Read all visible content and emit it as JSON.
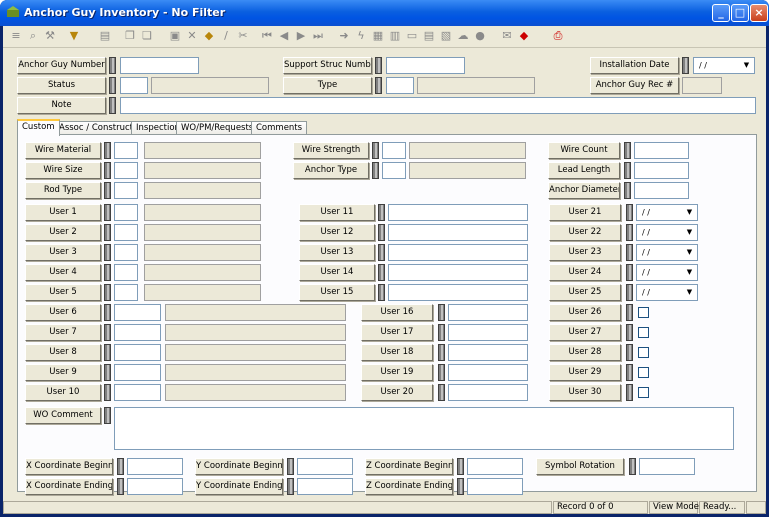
{
  "window": {
    "title": "Anchor Guy Inventory - No Filter"
  },
  "header_fields": {
    "anchor_guy_number": "Anchor Guy Number",
    "support_struc_number": "Support Struc Number",
    "installation_date": "Installation Date",
    "installation_date_value": "/ /",
    "status": "Status",
    "type": "Type",
    "anchor_guy_rec": "Anchor Guy Rec #",
    "note": "Note"
  },
  "tabs": [
    "Custom",
    "Assoc / Construct",
    "Inspection",
    "WO/PM/Requests",
    "Comments"
  ],
  "custom": {
    "wire_material": "Wire Material",
    "wire_size": "Wire Size",
    "rod_type": "Rod Type",
    "wire_strength": "Wire Strength",
    "anchor_type": "Anchor Type",
    "wire_count": "Wire Count",
    "lead_length": "Lead Length",
    "anchor_diameter": "Anchor Diameter",
    "users_col1": [
      "User 1",
      "User 2",
      "User 3",
      "User 4",
      "User 5",
      "User 6",
      "User 7",
      "User 8",
      "User 9",
      "User 10"
    ],
    "users_col2": [
      "User 11",
      "User 12",
      "User 13",
      "User 14",
      "User 15"
    ],
    "users_col2b": [
      "User 16",
      "User 17",
      "User 18",
      "User 19",
      "User 20"
    ],
    "users_col3": [
      "User 21",
      "User 22",
      "User 23",
      "User 24",
      "User 25"
    ],
    "users_col3b": [
      "User 26",
      "User 27",
      "User 28",
      "User 29",
      "User 30"
    ],
    "date_value": "/ /",
    "wo_comment": "WO Comment",
    "x_begin": "X Coordinate Beginning",
    "x_end": "X Coordinate Ending",
    "y_begin": "Y Coordinate Beginning",
    "y_end": "Y Coordinate Ending",
    "z_begin": "Z Coordinate Beginning",
    "z_end": "Z Coordinate Ending",
    "symbol_rotation": "Symbol Rotation"
  },
  "statusbar": {
    "record": "Record 0 of 0",
    "mode": "View Mode",
    "state": "Ready..."
  },
  "colors": {
    "titlebar": "#0054e3",
    "face": "#ece9d8",
    "tab_accent": "#ffc83c"
  }
}
